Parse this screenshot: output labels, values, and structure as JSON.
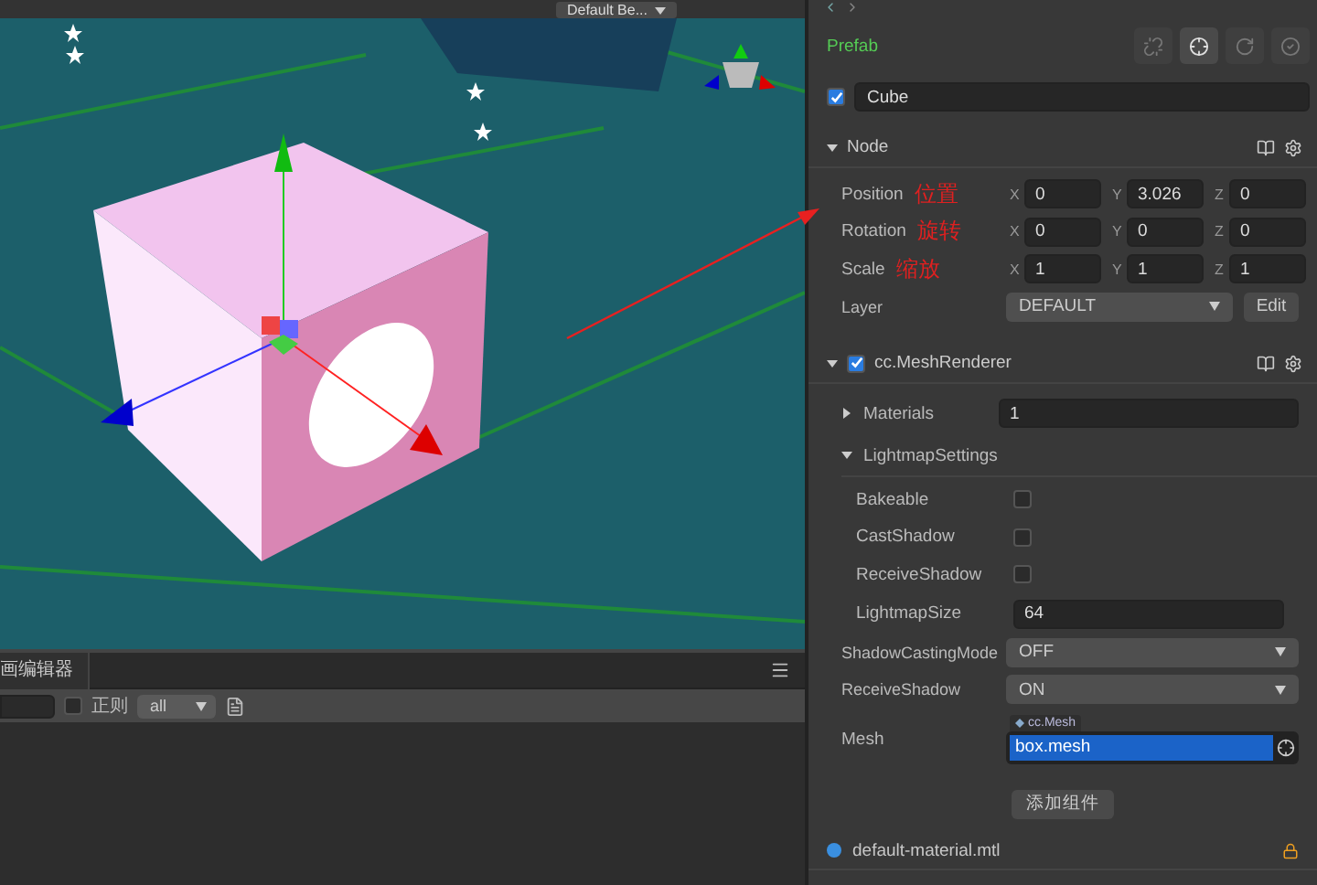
{
  "scene": {
    "toolbar": {
      "dropdown": "Default Be..."
    }
  },
  "bottom_panel": {
    "tab": "画编辑器",
    "regex": {
      "label": "正则",
      "checked": false
    },
    "filter": {
      "value": "all"
    }
  },
  "inspector": {
    "prefab": {
      "label": "Prefab"
    },
    "node": {
      "active": true,
      "name": "Cube"
    },
    "sections": [
      {
        "title": "Node",
        "expanded": true,
        "kind": "node",
        "rows": [
          {
            "kind": "vec3",
            "label": "Position",
            "note": "位置",
            "values": [
              {
                "axis": "X",
                "value": "0"
              },
              {
                "axis": "Y",
                "value": "3.026"
              },
              {
                "axis": "Z",
                "value": "0"
              }
            ]
          },
          {
            "kind": "vec3",
            "label": "Rotation",
            "note": "旋转",
            "values": [
              {
                "axis": "X",
                "value": "0"
              },
              {
                "axis": "Y",
                "value": "0"
              },
              {
                "axis": "Z",
                "value": "0"
              }
            ]
          },
          {
            "kind": "vec3",
            "label": "Scale",
            "note": "缩放",
            "values": [
              {
                "axis": "X",
                "value": "1"
              },
              {
                "axis": "Y",
                "value": "1"
              },
              {
                "axis": "Z",
                "value": "1"
              }
            ]
          },
          {
            "kind": "select",
            "label": "Layer",
            "value": "DEFAULT",
            "button": "Edit"
          }
        ]
      },
      {
        "title": "cc.MeshRenderer",
        "expanded": true,
        "kind": "component",
        "enabled": true,
        "rows": [
          {
            "kind": "group",
            "label": "Materials",
            "expanded": false,
            "value": "1"
          },
          {
            "kind": "group",
            "label": "LightmapSettings",
            "expanded": true,
            "children": [
              {
                "kind": "checkbox",
                "label": "Bakeable",
                "checked": false
              },
              {
                "kind": "checkbox",
                "label": "CastShadow",
                "checked": false
              },
              {
                "kind": "checkbox",
                "label": "ReceiveShadow",
                "checked": false
              },
              {
                "kind": "text",
                "label": "LightmapSize",
                "value": "64"
              }
            ]
          },
          {
            "kind": "select",
            "label": "ShadowCastingMode",
            "value": "OFF"
          },
          {
            "kind": "select",
            "label": "ReceiveShadow",
            "value": "ON"
          },
          {
            "kind": "asset",
            "label": "Mesh",
            "type": "cc.Mesh",
            "value": "box.mesh"
          }
        ]
      }
    ],
    "add_component": "添加组件",
    "assets": [
      {
        "name": "default-material.mtl",
        "locked": true
      }
    ]
  }
}
